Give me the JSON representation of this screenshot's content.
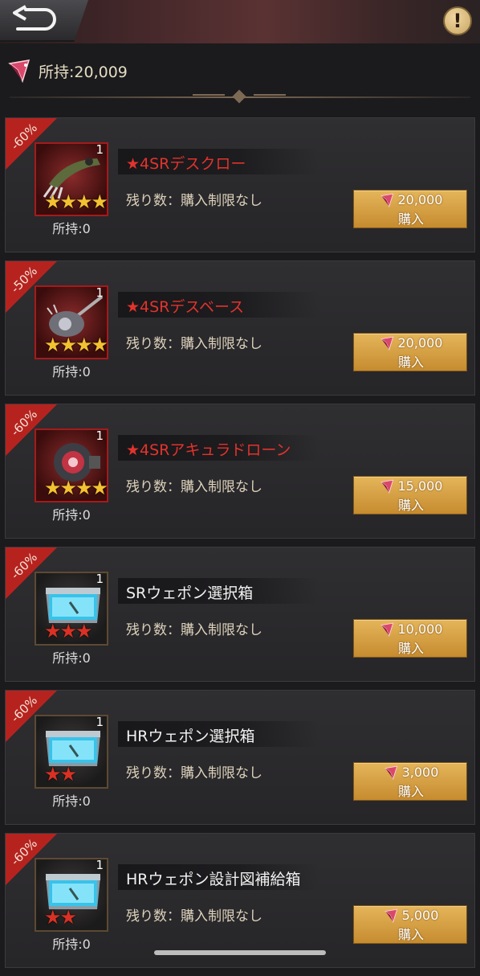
{
  "header": {
    "back_icon": "back-arrow-icon",
    "info_icon": "exclamation-icon",
    "info_label": "!"
  },
  "currency": {
    "icon": "red-gem-icon",
    "owned_text": "所持:20,009"
  },
  "colors": {
    "accent_red": "#b6231f",
    "button_gold": "#d9a44a",
    "title_red": "#e3332c",
    "star_gold": "#f3c230",
    "star_red": "#d93124"
  },
  "items": [
    {
      "discount": "-60%",
      "name": "★4SRデスクロー",
      "name_color": "red",
      "qty": "1",
      "stars": 4,
      "star_color": "gold",
      "thumb": "claw-weapon-icon",
      "owned": "所持:0",
      "remaining": "残り数：購入制限なし",
      "price": "20,000",
      "buy_label": "購入"
    },
    {
      "discount": "-50%",
      "name": "★4SRデスベース",
      "name_color": "red",
      "qty": "1",
      "stars": 4,
      "star_color": "gold",
      "thumb": "bass-guitar-weapon-icon",
      "owned": "所持:0",
      "remaining": "残り数：購入制限なし",
      "price": "20,000",
      "buy_label": "購入"
    },
    {
      "discount": "-60%",
      "name": "★4SRアキュラドローン",
      "name_color": "red",
      "qty": "1",
      "stars": 4,
      "star_color": "gold",
      "thumb": "drone-icon",
      "owned": "所持:0",
      "remaining": "残り数：購入制限なし",
      "price": "15,000",
      "buy_label": "購入"
    },
    {
      "discount": "-60%",
      "name": "SRウェポン選択箱",
      "name_color": "white",
      "qty": "1",
      "stars": 3,
      "star_color": "red",
      "thumb": "weapon-crate-icon",
      "owned": "所持:0",
      "remaining": "残り数：購入制限なし",
      "price": "10,000",
      "buy_label": "購入"
    },
    {
      "discount": "-60%",
      "name": "HRウェポン選択箱",
      "name_color": "white",
      "qty": "1",
      "stars": 2,
      "star_color": "red",
      "thumb": "weapon-crate-icon",
      "owned": "所持:0",
      "remaining": "残り数：購入制限なし",
      "price": "3,000",
      "buy_label": "購入"
    },
    {
      "discount": "-60%",
      "name": "HRウェポン設計図補給箱",
      "name_color": "white",
      "qty": "1",
      "stars": 2,
      "star_color": "red",
      "thumb": "weapon-crate-icon",
      "owned": "所持:0",
      "remaining": "残り数：購入制限なし",
      "price": "5,000",
      "buy_label": "購入"
    }
  ]
}
